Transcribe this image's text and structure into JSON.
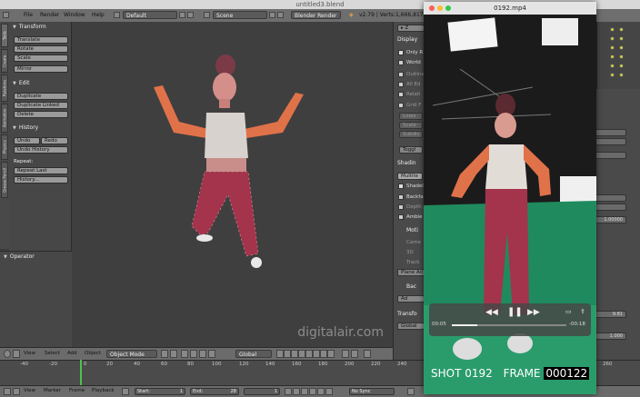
{
  "mac_titlebar": {
    "title": "untitled3.blend"
  },
  "blender_header": {
    "menus": [
      "File",
      "Render",
      "Window",
      "Help"
    ],
    "layout": "Default",
    "scene": "Scene",
    "engine": "Blender Render",
    "stats": "v2.79 | Verts:1,666,817 | Fac"
  },
  "tool_tabs": [
    "Tools",
    "Create",
    "Relations",
    "Animation",
    "Physics",
    "Grease Pencil"
  ],
  "tool_shelf": {
    "transform": {
      "title": "Transform",
      "buttons": [
        "Translate",
        "Rotate",
        "Scale",
        "Mirror"
      ]
    },
    "edit": {
      "title": "Edit",
      "buttons": [
        "Duplicate",
        "Duplicate Linked",
        "Delete"
      ]
    },
    "history": {
      "title": "History",
      "undo": "Undo",
      "redo": "Redo",
      "undo_history": "Undo History",
      "repeat_label": "Repeat:",
      "repeat_last": "Repeat Last",
      "history": "History..."
    },
    "operator": {
      "title": "Operator"
    }
  },
  "viewport": {
    "watermark": "digitalair.com"
  },
  "viewport_header": {
    "menus": [
      "View",
      "Select",
      "Add",
      "Object"
    ],
    "mode": "Object Mode",
    "orientation": "Global"
  },
  "timeline": {
    "ticks": [
      "-40",
      "-20",
      "0",
      "20",
      "40",
      "60",
      "80",
      "100",
      "120",
      "140",
      "160",
      "180",
      "200",
      "220",
      "240",
      "260"
    ],
    "header_menus": [
      "View",
      "Marker",
      "Frame",
      "Playback"
    ],
    "start_label": "Start:",
    "start": "1",
    "end_label": "End:",
    "end": "28",
    "current": "1",
    "sync": "No Sync"
  },
  "properties": {
    "display": "Display",
    "only_render": "Only R",
    "world_bg": "World",
    "outline": "Outline",
    "all_ed": "All Ed",
    "relations": "Relati",
    "grid_floor": "Grid F",
    "lines": "Lines",
    "scale": "Scale",
    "subdiv": "Subdiv",
    "toggle": "Toggl",
    "shading": "Shadin",
    "multitex": "Multite",
    "shadeless": "Shadel",
    "backface": "Backfa",
    "depth": "Depth",
    "ambient": "Ambie",
    "motion": "Moti",
    "camera": "Came",
    "fps_3d": "3D",
    "track": "Track",
    "plane_add": "Plane Ad",
    "background": "Bac",
    "add": "Ad",
    "transform": "Transfo",
    "global": "Global",
    "value_1": "1.00000",
    "value_2": "9.81",
    "value_3": "1.000"
  },
  "player": {
    "title": "0192.mp4",
    "elapsed": "00:05",
    "remaining": "-00:18",
    "progress": 0.22,
    "shot_label": "SHOT 0192",
    "frame_label": "FRAME",
    "frame_number": "000122"
  },
  "colors": {
    "accent_green": "#4cc34c",
    "mac_red": "#fc5f57",
    "mac_yellow": "#fdbc2e",
    "mac_green": "#34c84a"
  }
}
